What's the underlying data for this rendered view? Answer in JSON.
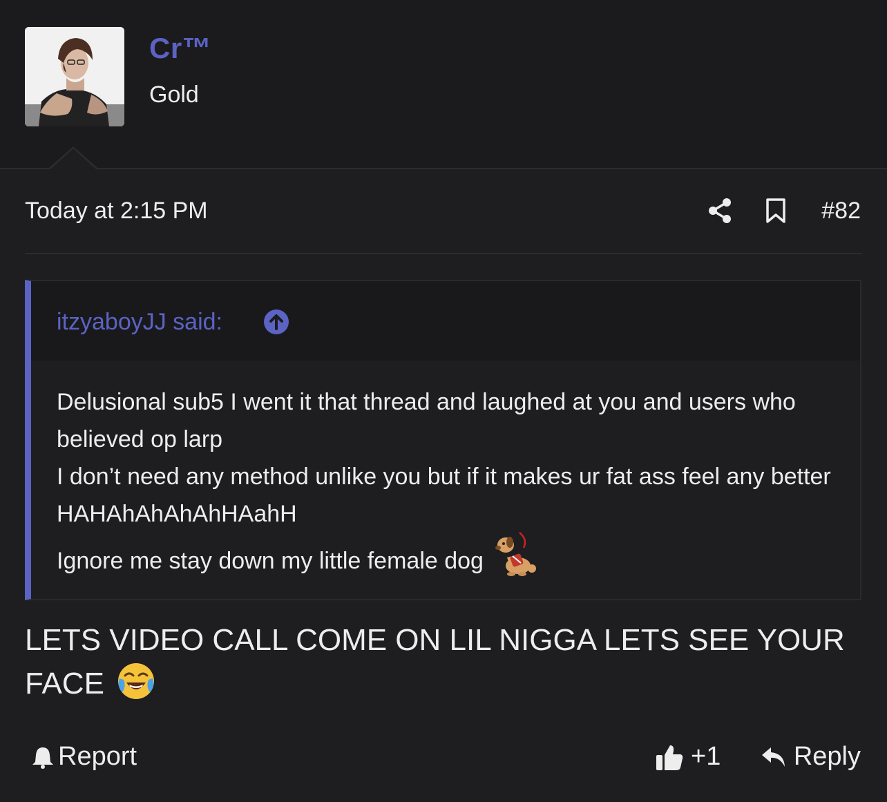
{
  "author": {
    "username": "Cr™",
    "title": "Gold",
    "avatar_icon": "avatar-muscular-man"
  },
  "meta": {
    "timestamp": "Today at 2:15 PM",
    "share_icon": "share-icon",
    "bookmark_icon": "bookmark-icon",
    "post_number": "#82"
  },
  "quote": {
    "author_label": "itzyaboyJJ said:",
    "jump_icon": "arrow-up-circle-icon",
    "lines": [
      "Delusional sub5 I went it that thread and laughed at you and users who believed op larp",
      "I don’t need any method unlike you but if it makes ur fat ass feel any better HAHAhAhAhAhHAahH"
    ],
    "last_line": "Ignore me stay down my little female dog",
    "last_line_emoji": "service-dog-emoji"
  },
  "message": {
    "text": "LETS VIDEO CALL COME ON LIL NIGGA LETS SEE YOUR FACE",
    "emoji": "loudly-crying-laughing-emoji"
  },
  "footer": {
    "report_label": "Report",
    "like_count": "+1",
    "reply_label": "Reply"
  },
  "colors": {
    "accent": "#5b63c4",
    "background": "#1e1e20",
    "header_background": "#1b1b1d",
    "text": "#ededed"
  }
}
